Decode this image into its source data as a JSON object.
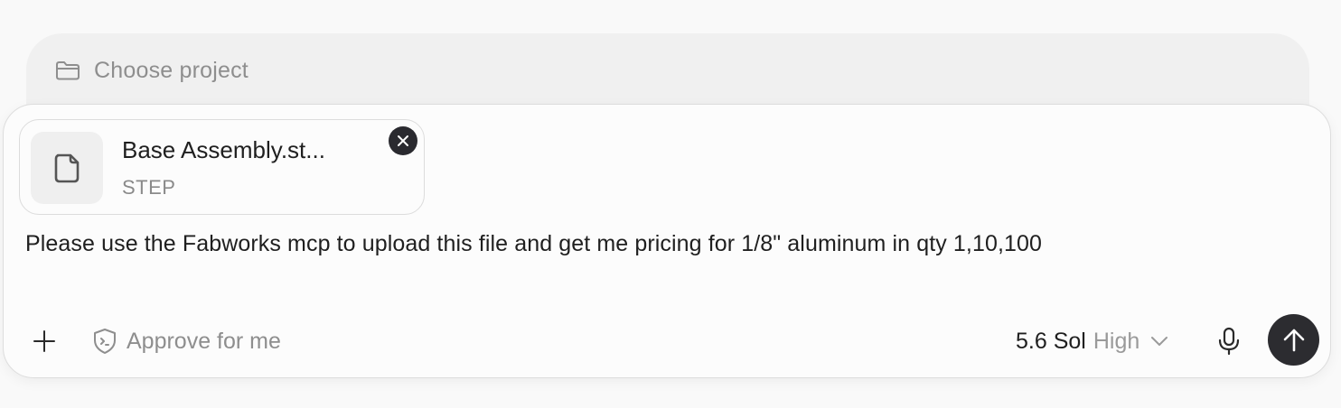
{
  "project": {
    "label": "Choose project",
    "icon": "folder-icon"
  },
  "attachment": {
    "file_name": "Base Assembly.st...",
    "file_type": "STEP",
    "icon": "file-icon",
    "remove_icon": "close-icon"
  },
  "prompt": {
    "text": "Please use the Fabworks mcp to upload this file and get me pricing for 1/8\" aluminum in qty 1,10,100"
  },
  "toolbar": {
    "add_icon": "plus-icon",
    "approve_label": "Approve for me",
    "approve_icon": "shield-terminal-icon",
    "model": "5.6 Sol",
    "effort": "High",
    "chevron_icon": "chevron-down-icon",
    "mic_icon": "microphone-icon",
    "send_icon": "arrow-up-icon"
  },
  "colors": {
    "background": "#f9f9f9",
    "project_bar": "#f0f0f0",
    "composer": "#fcfcfc",
    "send_button": "#2c2c30",
    "muted_text": "#8e8e8e",
    "primary_text": "#1f1f1f"
  }
}
